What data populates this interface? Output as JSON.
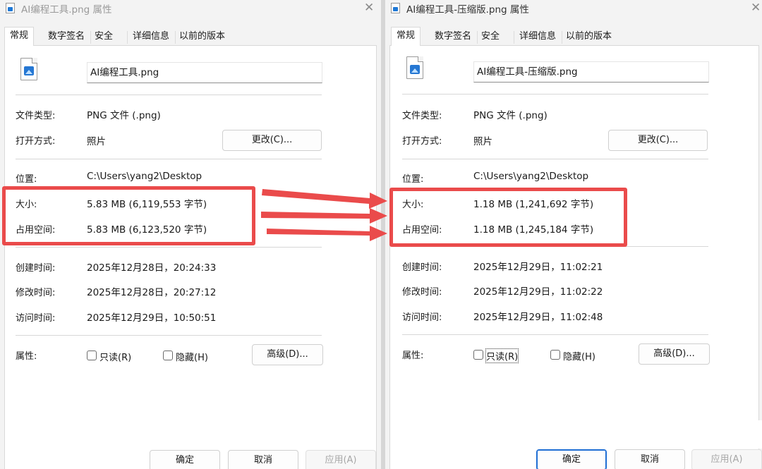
{
  "left": {
    "title": "AI编程工具.png 属性",
    "tabs": [
      "常规",
      "数字签名",
      "安全",
      "详细信息",
      "以前的版本"
    ],
    "filename": "AI编程工具.png",
    "type_label": "文件类型:",
    "type_value": "PNG 文件 (.png)",
    "open_label": "打开方式:",
    "open_value": "照片",
    "change_button": "更改(C)...",
    "location_label": "位置:",
    "location_value": "C:\\Users\\yang2\\Desktop",
    "size_label": "大小:",
    "size_value": "5.83 MB (6,119,553 字节)",
    "disk_label": "占用空间:",
    "disk_value": "5.83 MB (6,123,520 字节)",
    "created_label": "创建时间:",
    "created_value": "2025年12月28日，20:24:33",
    "modified_label": "修改时间:",
    "modified_value": "2025年12月28日，20:27:12",
    "accessed_label": "访问时间:",
    "accessed_value": "2025年12月29日，10:50:51",
    "attr_label": "属性:",
    "readonly_label": "只读(R)",
    "hidden_label": "隐藏(H)",
    "advanced_button": "高级(D)...",
    "ok_button": "确定",
    "cancel_button": "取消",
    "apply_button": "应用(A)"
  },
  "right": {
    "title": "AI编程工具-压缩版.png 属性",
    "tabs": [
      "常规",
      "数字签名",
      "安全",
      "详细信息",
      "以前的版本"
    ],
    "filename": "AI编程工具-压缩版.png",
    "type_label": "文件类型:",
    "type_value": "PNG 文件 (.png)",
    "open_label": "打开方式:",
    "open_value": "照片",
    "change_button": "更改(C)...",
    "location_label": "位置:",
    "location_value": "C:\\Users\\yang2\\Desktop",
    "size_label": "大小:",
    "size_value": "1.18 MB (1,241,692 字节)",
    "disk_label": "占用空间:",
    "disk_value": "1.18 MB (1,245,184 字节)",
    "created_label": "创建时间:",
    "created_value": "2025年12月29日，11:02:21",
    "modified_label": "修改时间:",
    "modified_value": "2025年12月29日，11:02:22",
    "accessed_label": "访问时间:",
    "accessed_value": "2025年12月29日，11:02:48",
    "attr_label": "属性:",
    "readonly_label": "只读(R)",
    "hidden_label": "隐藏(H)",
    "advanced_button": "高级(D)...",
    "ok_button": "确定",
    "cancel_button": "取消",
    "apply_button": "应用(A)"
  },
  "colors": {
    "highlight": "#ea4b4b",
    "accent": "#1f6ed4"
  }
}
